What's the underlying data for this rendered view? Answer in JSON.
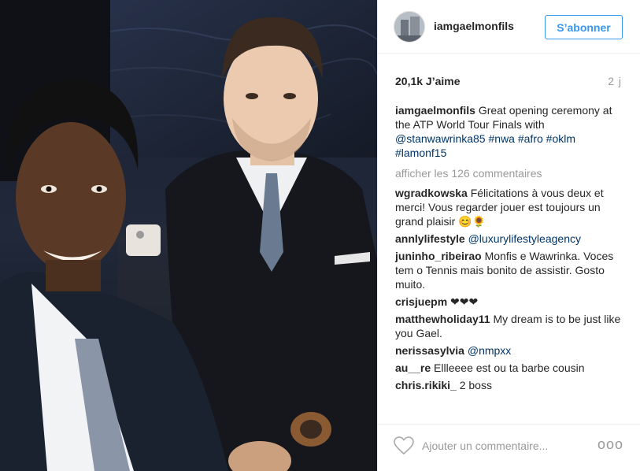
{
  "post": {
    "username": "iamgaelmonfils",
    "follow_label": "S’abonner",
    "likes": "20,1k J’aime",
    "age": "2 j"
  },
  "caption": {
    "username": "iamgaelmonfils",
    "text_1": "Great opening ceremony at the ATP World Tour Finals with",
    "mention": "@stanwawrinka85",
    "hashtags": "#nwa #afro #oklm #lamonf15"
  },
  "view_all": "afficher les 126 commentaires",
  "comments": [
    {
      "user": "wgradkowska",
      "text": "Félicitations à vous deux et merci! Vous regarder jouer est toujours un grand plaisir 😊🌻"
    },
    {
      "user": "annlylifestyle",
      "text": "@luxurylifestyleagency"
    },
    {
      "user": "juninho_ribeirao",
      "text": "Monfis e Wawrinka. Voces tem o Tennis mais bonito de assistir. Gosto muito."
    },
    {
      "user": "crisjuepm",
      "text": "❤❤❤"
    },
    {
      "user": "matthewholiday11",
      "text": "My dream is to be just like you Gael."
    },
    {
      "user": "nerissasylvia",
      "text": "@nmpxx"
    },
    {
      "user": "au__re",
      "text": "Ellleeee est ou ta barbe cousin"
    },
    {
      "user": "chris.rikiki_",
      "text": "2 boss"
    }
  ],
  "footer": {
    "comment_placeholder": "Ajouter un commentaire...",
    "more_label": "ooo"
  },
  "colors": {
    "accent": "#3897f0",
    "link": "#003569",
    "muted": "#999999"
  },
  "icons": {
    "like": "heart-icon",
    "more": "more-options-icon"
  }
}
